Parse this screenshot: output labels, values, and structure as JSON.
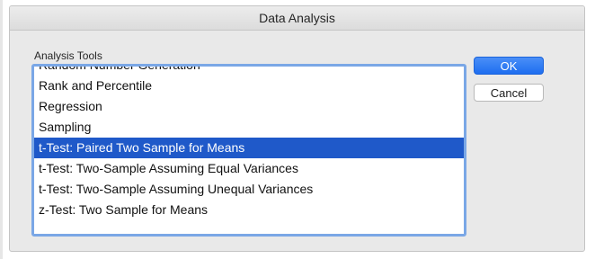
{
  "dialog": {
    "title": "Data Analysis",
    "section_label": "Analysis Tools",
    "items": [
      "Random Number Generation",
      "Rank and Percentile",
      "Regression",
      "Sampling",
      "t-Test: Paired Two Sample for Means",
      "t-Test: Two-Sample Assuming Equal Variances",
      "t-Test: Two-Sample Assuming Unequal Variances",
      "z-Test: Two Sample for Means"
    ],
    "selected_index": 4,
    "ok_label": "OK",
    "cancel_label": "Cancel"
  },
  "colors": {
    "selection": "#1f59c9",
    "primary_button": "#1e6ef0",
    "list_focus_ring": "#7aa7e6"
  }
}
